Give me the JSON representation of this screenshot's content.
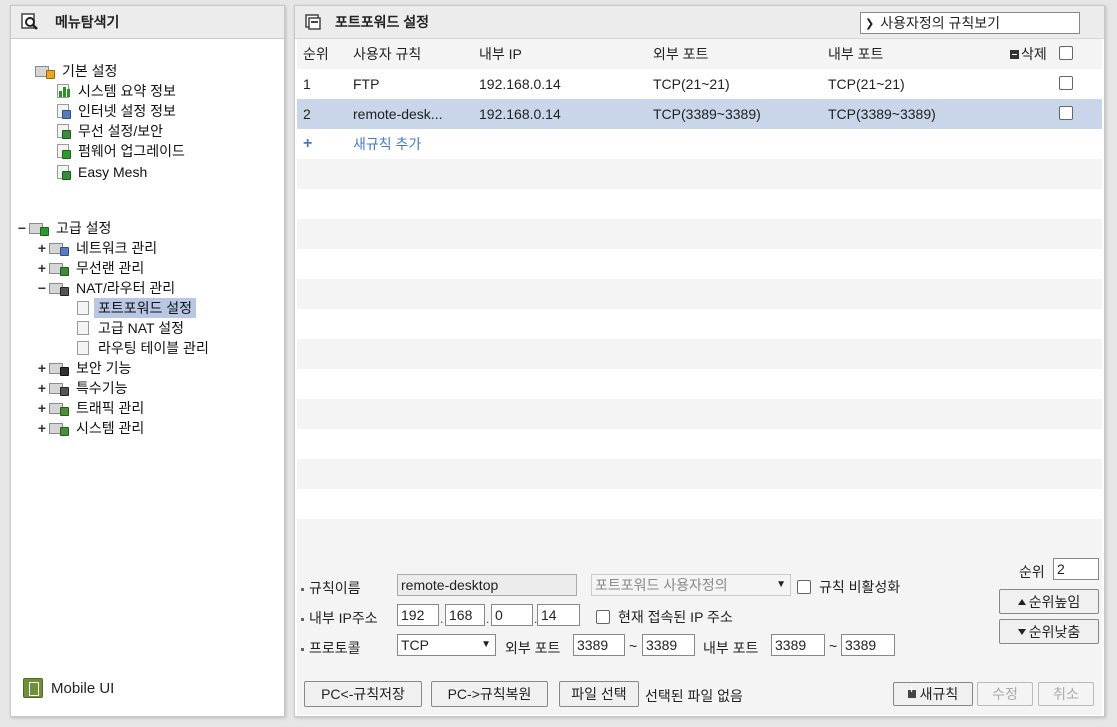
{
  "left": {
    "title": "메뉴탐색기",
    "basic": {
      "label": "기본 설정",
      "items": [
        "시스템 요약 정보",
        "인터넷 설정 정보",
        "무선 설정/보안",
        "펌웨어 업그레이드",
        "Easy Mesh"
      ]
    },
    "advanced": {
      "label": "고급 설정",
      "expand_symbol": "−",
      "network": "네트워크 관리",
      "wlan": "무선랜 관리",
      "nat": "NAT/라우터 관리",
      "nat_children": [
        "포트포워드 설정",
        "고급 NAT 설정",
        "라우팅 테이블 관리"
      ],
      "security": "보안 기능",
      "special": "특수기능",
      "traffic": "트래픽 관리",
      "system": "시스템 관리",
      "plus": "+",
      "minus": "−"
    },
    "mobile": "Mobile UI"
  },
  "right": {
    "title": "포트포워드 설정",
    "view_select": "사용자정의 규칙보기",
    "columns": {
      "no": "순위",
      "name": "사용자 규칙",
      "ip": "내부 IP",
      "ext": "외부 포트",
      "int": "내부 포트",
      "del": "삭제"
    },
    "rows": [
      {
        "no": "1",
        "name": "FTP",
        "ip": "192.168.0.14",
        "ext": "TCP(21~21)",
        "int": "TCP(21~21)"
      },
      {
        "no": "2",
        "name": "remote-desk...",
        "ip": "192.168.0.14",
        "ext": "TCP(3389~3389)",
        "int": "TCP(3389~3389)"
      }
    ],
    "add_plus": "+",
    "add_rule": "새규칙 추가"
  },
  "form": {
    "rule_name_label": "규칙이름",
    "rule_name_value": "remote-desktop",
    "preset_select": "포트포워드 사용자정의",
    "disable_label": "규칙 비활성화",
    "ip_label": "내부 IP주소",
    "ip": [
      "192",
      "168",
      "0",
      "14"
    ],
    "current_ip_label": "현재 접속된 IP 주소",
    "protocol_label": "프로토콜",
    "protocol_value": "TCP",
    "ext_port_label": "외부 포트",
    "ext_from": "3389",
    "ext_to": "3389",
    "int_port_label": "내부 포트",
    "int_from": "3389",
    "int_to": "3389",
    "tilde": "~",
    "ip_dot": ".",
    "priority_label": "순위",
    "priority_value": "2",
    "priority_up": "순위높임",
    "priority_down": "순위낮춤",
    "btn_save_pc": "PC<-규칙저장",
    "btn_restore_pc": "PC->규칙복원",
    "btn_file": "파일 선택",
    "file_status": "선택된 파일 없음",
    "btn_new": "새규칙",
    "btn_modify": "수정",
    "btn_cancel": "취소"
  },
  "colors": {
    "selected_row": "#c9d6ea",
    "tree_selected": "#b8c8e4",
    "link_blue": "#4a78c8"
  }
}
